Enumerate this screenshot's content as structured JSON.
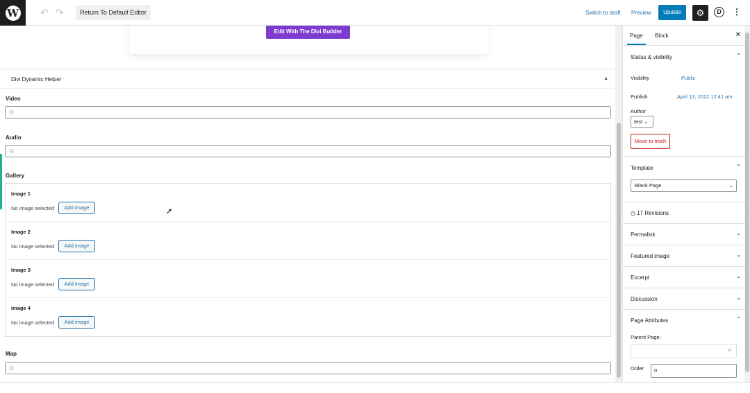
{
  "topbar": {
    "undo_glyph": "↶",
    "redo_glyph": "↷",
    "return_label": "Return To Default Editor",
    "switch_draft_label": "Switch to draft",
    "preview_label": "Preview",
    "update_label": "Update",
    "settings_glyph": "⚙",
    "divi_glyph": "D",
    "more_glyph": "⋮"
  },
  "main": {
    "divi_button_label": "Edit With The Divi Builder",
    "metabox_title": "Divi Dynamic Helper",
    "metabox_toggle": "▲",
    "fields": {
      "video_label": "Video",
      "audio_label": "Audio",
      "gallery_label": "Gallery",
      "map_label": "Map"
    },
    "gallery": [
      {
        "title": "Image 1",
        "status": "No image selected",
        "button": "Add image"
      },
      {
        "title": "Image 2",
        "status": "No image selected",
        "button": "Add image"
      },
      {
        "title": "Image 3",
        "status": "No image selected",
        "button": "Add image"
      },
      {
        "title": "Image 4",
        "status": "No image selected",
        "button": "Add image"
      }
    ]
  },
  "sidebar": {
    "tabs": [
      "Page",
      "Block"
    ],
    "close_glyph": "✕",
    "status_visibility": {
      "title": "Status & visibility",
      "visibility_label": "Visibility",
      "visibility_value": "Public",
      "publish_label": "Publish",
      "publish_value": "April 13, 2022 12:41 am",
      "author_label": "Author",
      "author_value": "test",
      "trash_label": "Move to trash"
    },
    "template": {
      "title": "Template",
      "selected": "Blank Page"
    },
    "revisions_label": "17 Revisions",
    "collapsed_sections": [
      "Permalink",
      "Featured image",
      "Excerpt",
      "Discussion"
    ],
    "page_attributes": {
      "title": "Page Attributes",
      "parent_label": "Parent Page:",
      "order_label": "Order",
      "order_value": "0"
    }
  },
  "colors": {
    "accent": "#007cba",
    "divi_purple": "#7e3bd0",
    "link": "#2271b1",
    "danger": "#cc1818",
    "left_accent": "#1cb495"
  }
}
